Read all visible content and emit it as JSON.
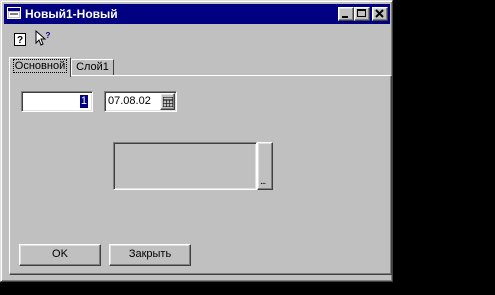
{
  "window": {
    "title": "Новый1-Новый",
    "controls": {
      "minimize": "minimize",
      "maximize": "maximize",
      "close": "close"
    }
  },
  "toolbar": {
    "help_icon": "help-icon",
    "whats_this_icon": "whats-this-pointer-icon"
  },
  "tabs": [
    {
      "label": "Основной",
      "selected": true
    },
    {
      "label": "Слой1",
      "selected": false
    }
  ],
  "form": {
    "number_value": "1",
    "date_value": "07.08.02",
    "calendar_icon": "calendar-icon",
    "ellipsis_label": "..."
  },
  "buttons": {
    "ok": "OK",
    "close": "Закрыть"
  },
  "colors": {
    "title_bar": "#000080",
    "face": "#c0c0c0",
    "desktop": "#000000",
    "selection": "#000080"
  }
}
